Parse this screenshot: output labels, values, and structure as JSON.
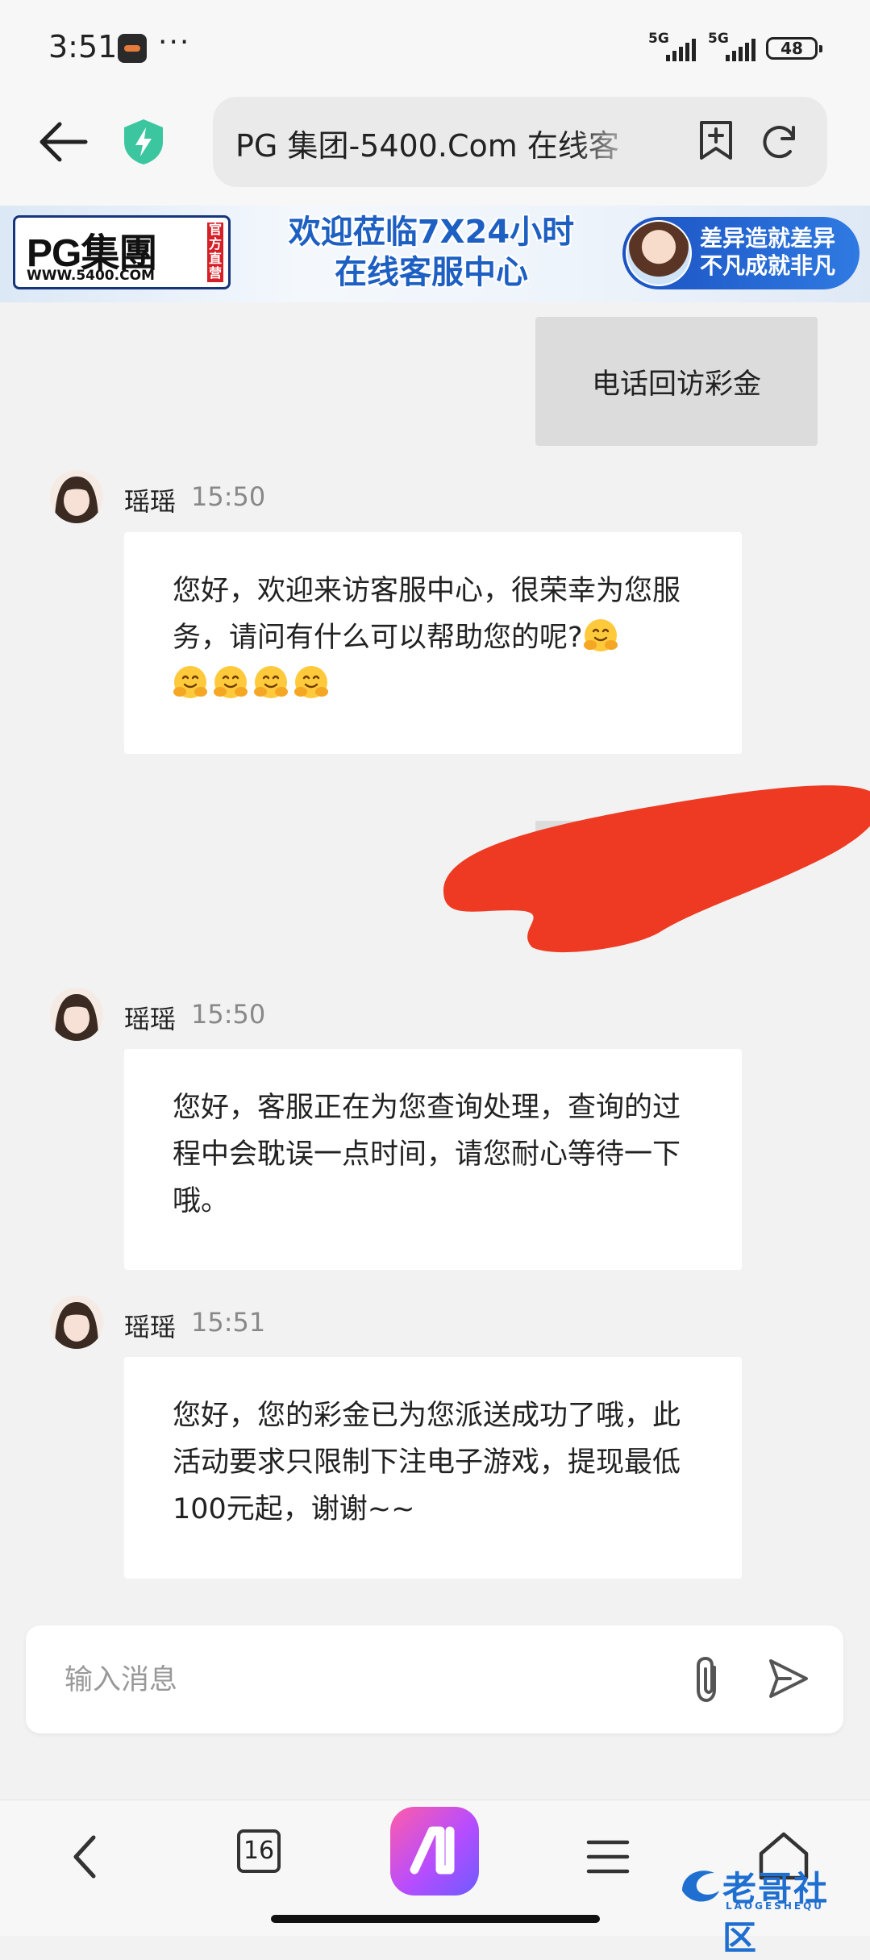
{
  "status_bar": {
    "time": "3:51",
    "more": "···",
    "signal_1": "5G",
    "signal_2": "5G",
    "battery": "48"
  },
  "browser": {
    "url_text": "PG 集团-5400.Com 在线客"
  },
  "banner": {
    "logo_name": "PG集團",
    "logo_site": "WWW.5400.COM",
    "logo_badge": "官方直营",
    "title_line1": "欢迎莅临7X24小时",
    "title_line2": "在线客服中心",
    "slogan_line1": "差异造就差异",
    "slogan_line2": "不凡成就非凡"
  },
  "chat": {
    "user_message_1": "电话回访彩金",
    "messages": [
      {
        "sender": "瑶瑶",
        "time": "15:50",
        "text": "您好，欢迎来访客服中心，很荣幸为您服务，请问有什么可以帮助您的呢?"
      },
      {
        "sender": "瑶瑶",
        "time": "15:50",
        "text": "您好，客服正在为您查询处理，查询的过程中会耽误一点时间，请您耐心等待一下哦。"
      },
      {
        "sender": "瑶瑶",
        "time": "15:51",
        "text": "您好，您的彩金已为您派送成功了哦，此活动要求只限制下注电子游戏，提现最低100元起，谢谢~~"
      }
    ]
  },
  "input": {
    "placeholder": "输入消息"
  },
  "bottom_nav": {
    "tabs_count": "16"
  },
  "watermark": {
    "text": "老哥社区",
    "sub": "LAOGESHEQU"
  },
  "icons": [
    "back-arrow-icon",
    "shield-bolt-icon",
    "bookmark-add-icon",
    "reload-icon",
    "hugging-face-emoji-icon",
    "paperclip-icon",
    "send-icon",
    "chevron-left-icon",
    "menu-icon",
    "home-icon"
  ],
  "colors": {
    "accent_green": "#3cc6a0",
    "brand_blue": "#1d5fc2",
    "redaction_red": "#ee3a22",
    "ai_gradient_start": "#ff5ca8",
    "ai_gradient_end": "#6d5bff"
  }
}
